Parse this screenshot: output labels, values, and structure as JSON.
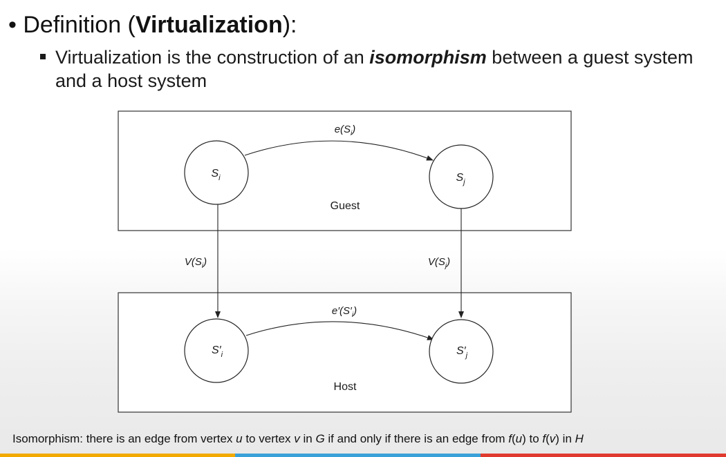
{
  "title": {
    "prefix": "Definition (",
    "bold": "Virtualization",
    "suffix": "):"
  },
  "bullet": {
    "before": "Virtualization is the construction of an ",
    "emphasis": "isomorphism",
    "after": " between a guest system and a host system"
  },
  "diagram": {
    "guest_label": "Guest",
    "host_label": "Host",
    "nodes": {
      "si": {
        "main": "S",
        "sub": "i"
      },
      "sj": {
        "main": "S",
        "sub": "j"
      },
      "si_prime": {
        "main": "S′",
        "sub": "i"
      },
      "sj_prime": {
        "main": "S′",
        "sub": "j"
      }
    },
    "edges": {
      "e_top": {
        "fn": "e(S",
        "sub": "i",
        "close": ")"
      },
      "e_bottom": {
        "fn": "e′(S′",
        "sub": "i",
        "close": ")"
      },
      "v_left": {
        "fn": "V(S",
        "sub": "i",
        "close": ")"
      },
      "v_right": {
        "fn": "V(S",
        "sub": "j",
        "close": ")"
      }
    }
  },
  "footer": {
    "parts": [
      {
        "text": "Isomorphism: there is an edge from vertex ",
        "italic": false
      },
      {
        "text": "u",
        "italic": true
      },
      {
        "text": " to vertex ",
        "italic": false
      },
      {
        "text": "v",
        "italic": true
      },
      {
        "text": " in ",
        "italic": false
      },
      {
        "text": "G",
        "italic": true
      },
      {
        "text": " if and only if there is an edge from ",
        "italic": false
      },
      {
        "text": "f",
        "italic": true
      },
      {
        "text": "(",
        "italic": false
      },
      {
        "text": "u",
        "italic": true
      },
      {
        "text": ") to ",
        "italic": false
      },
      {
        "text": "f",
        "italic": true
      },
      {
        "text": "(",
        "italic": false
      },
      {
        "text": "v",
        "italic": true
      },
      {
        "text": ") in ",
        "italic": false
      },
      {
        "text": "H",
        "italic": true
      }
    ]
  },
  "colors": {
    "strip": [
      "#f2a900",
      "#3aa0d8",
      "#e03a2f"
    ]
  }
}
